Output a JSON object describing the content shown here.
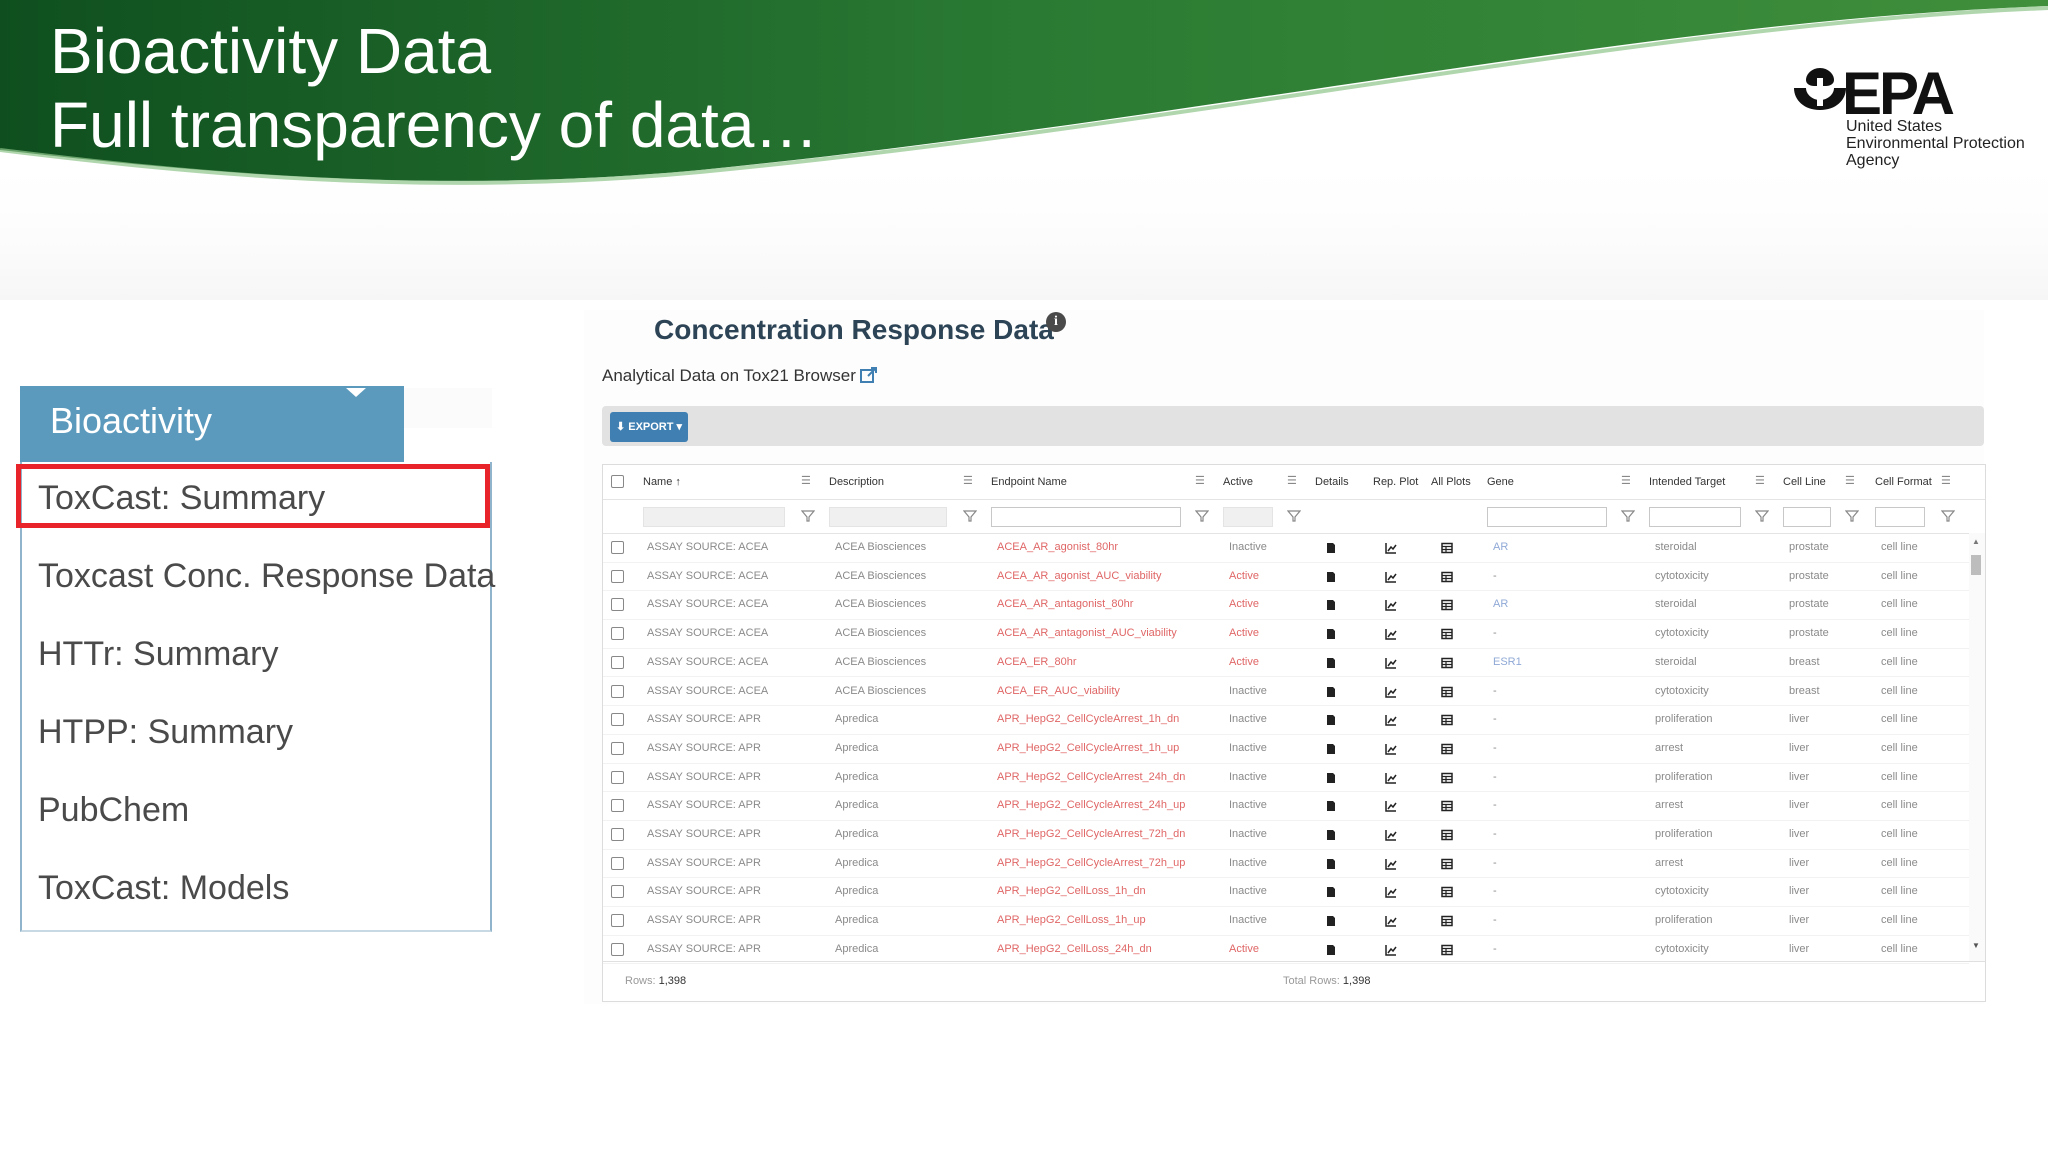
{
  "slide": {
    "title_line1": "Bioactivity Data",
    "title_line2": "Full transparency of data…",
    "banner_color": "#1f6b2a"
  },
  "epa_logo": {
    "wordmark": "EPA",
    "line1": "United States",
    "line2": "Environmental Protection",
    "line3": "Agency"
  },
  "sidebar": {
    "header": "Bioactivity",
    "header_color": "#5b9abd",
    "highlight_color": "#e8232a",
    "items": [
      {
        "label": "ToxCast: Summary",
        "highlighted": true
      },
      {
        "label": "Toxcast Conc. Response Data"
      },
      {
        "label": "HTTr: Summary"
      },
      {
        "label": "HTPP: Summary"
      },
      {
        "label": "PubChem"
      },
      {
        "label": "ToxCast: Models"
      }
    ]
  },
  "panel": {
    "title": "Concentration Response Data",
    "info_icon": "info-icon",
    "analytical_link": "Analytical Data on Tox21 Browser",
    "export_label": "EXPORT ▾",
    "export_color": "#3f7fb1"
  },
  "grid": {
    "columns": [
      "Name ↑",
      "Description",
      "Endpoint Name",
      "Active",
      "Details",
      "Rep. Plot",
      "All Plots",
      "Gene",
      "Intended Target",
      "Cell Line",
      "Cell Format"
    ],
    "rows": [
      {
        "name": "ASSAY SOURCE: ACEA",
        "description": "ACEA Biosciences",
        "endpoint": "ACEA_AR_agonist_80hr",
        "active": "Inactive",
        "gene": "AR",
        "target": "steroidal",
        "cell_line": "prostate",
        "cell_format": "cell line"
      },
      {
        "name": "ASSAY SOURCE: ACEA",
        "description": "ACEA Biosciences",
        "endpoint": "ACEA_AR_agonist_AUC_viability",
        "active": "Active",
        "gene": "-",
        "target": "cytotoxicity",
        "cell_line": "prostate",
        "cell_format": "cell line"
      },
      {
        "name": "ASSAY SOURCE: ACEA",
        "description": "ACEA Biosciences",
        "endpoint": "ACEA_AR_antagonist_80hr",
        "active": "Active",
        "gene": "AR",
        "target": "steroidal",
        "cell_line": "prostate",
        "cell_format": "cell line"
      },
      {
        "name": "ASSAY SOURCE: ACEA",
        "description": "ACEA Biosciences",
        "endpoint": "ACEA_AR_antagonist_AUC_viability",
        "active": "Active",
        "gene": "-",
        "target": "cytotoxicity",
        "cell_line": "prostate",
        "cell_format": "cell line"
      },
      {
        "name": "ASSAY SOURCE: ACEA",
        "description": "ACEA Biosciences",
        "endpoint": "ACEA_ER_80hr",
        "active": "Active",
        "gene": "ESR1",
        "target": "steroidal",
        "cell_line": "breast",
        "cell_format": "cell line"
      },
      {
        "name": "ASSAY SOURCE: ACEA",
        "description": "ACEA Biosciences",
        "endpoint": "ACEA_ER_AUC_viability",
        "active": "Inactive",
        "gene": "-",
        "target": "cytotoxicity",
        "cell_line": "breast",
        "cell_format": "cell line"
      },
      {
        "name": "ASSAY SOURCE: APR",
        "description": "Apredica",
        "endpoint": "APR_HepG2_CellCycleArrest_1h_dn",
        "active": "Inactive",
        "gene": "-",
        "target": "proliferation",
        "cell_line": "liver",
        "cell_format": "cell line"
      },
      {
        "name": "ASSAY SOURCE: APR",
        "description": "Apredica",
        "endpoint": "APR_HepG2_CellCycleArrest_1h_up",
        "active": "Inactive",
        "gene": "-",
        "target": "arrest",
        "cell_line": "liver",
        "cell_format": "cell line"
      },
      {
        "name": "ASSAY SOURCE: APR",
        "description": "Apredica",
        "endpoint": "APR_HepG2_CellCycleArrest_24h_dn",
        "active": "Inactive",
        "gene": "-",
        "target": "proliferation",
        "cell_line": "liver",
        "cell_format": "cell line"
      },
      {
        "name": "ASSAY SOURCE: APR",
        "description": "Apredica",
        "endpoint": "APR_HepG2_CellCycleArrest_24h_up",
        "active": "Inactive",
        "gene": "-",
        "target": "arrest",
        "cell_line": "liver",
        "cell_format": "cell line"
      },
      {
        "name": "ASSAY SOURCE: APR",
        "description": "Apredica",
        "endpoint": "APR_HepG2_CellCycleArrest_72h_dn",
        "active": "Inactive",
        "gene": "-",
        "target": "proliferation",
        "cell_line": "liver",
        "cell_format": "cell line"
      },
      {
        "name": "ASSAY SOURCE: APR",
        "description": "Apredica",
        "endpoint": "APR_HepG2_CellCycleArrest_72h_up",
        "active": "Inactive",
        "gene": "-",
        "target": "arrest",
        "cell_line": "liver",
        "cell_format": "cell line"
      },
      {
        "name": "ASSAY SOURCE: APR",
        "description": "Apredica",
        "endpoint": "APR_HepG2_CellLoss_1h_dn",
        "active": "Inactive",
        "gene": "-",
        "target": "cytotoxicity",
        "cell_line": "liver",
        "cell_format": "cell line"
      },
      {
        "name": "ASSAY SOURCE: APR",
        "description": "Apredica",
        "endpoint": "APR_HepG2_CellLoss_1h_up",
        "active": "Inactive",
        "gene": "-",
        "target": "proliferation",
        "cell_line": "liver",
        "cell_format": "cell line"
      },
      {
        "name": "ASSAY SOURCE: APR",
        "description": "Apredica",
        "endpoint": "APR_HepG2_CellLoss_24h_dn",
        "active": "Active",
        "gene": "-",
        "target": "cytotoxicity",
        "cell_line": "liver",
        "cell_format": "cell line"
      }
    ],
    "footer_rows_label": "Rows:",
    "footer_rows_value": "1,398",
    "footer_total_label": "Total Rows:",
    "footer_total_value": "1,398",
    "row_icons": [
      "document-icon",
      "line-chart-icon",
      "table-icon"
    ]
  }
}
